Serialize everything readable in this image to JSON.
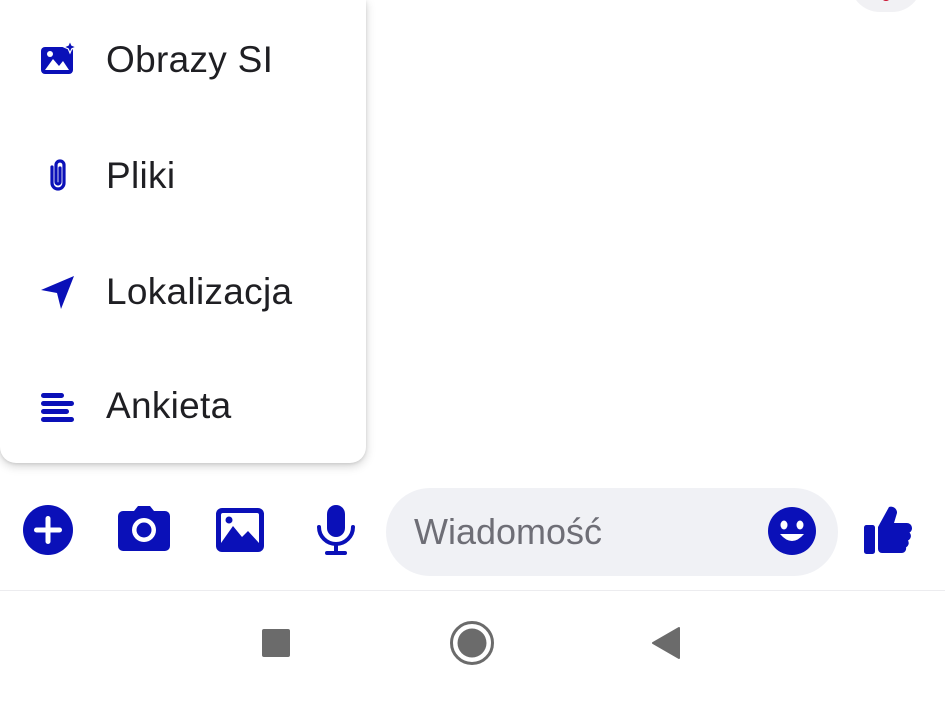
{
  "colors": {
    "accent": "#0a10b8",
    "text": "#1f1f23",
    "placeholder": "#6e6e76",
    "field_bg": "#f0f1f5",
    "nav_icon": "#6b6b6b"
  },
  "menu": {
    "items": [
      {
        "label": "Obrazy SI",
        "icon": "ai-image-icon"
      },
      {
        "label": "Pliki",
        "icon": "paperclip-icon"
      },
      {
        "label": "Lokalizacja",
        "icon": "location-arrow-icon"
      },
      {
        "label": "Ankieta",
        "icon": "poll-icon"
      }
    ]
  },
  "composer": {
    "buttons": [
      {
        "icon": "plus-circle-icon"
      },
      {
        "icon": "camera-icon"
      },
      {
        "icon": "gallery-icon"
      },
      {
        "icon": "microphone-icon"
      }
    ],
    "placeholder": "Wiadomość",
    "emoji_icon": "emoji-icon",
    "like_icon": "thumbs-up-icon"
  },
  "nav": {
    "buttons": [
      {
        "icon": "recents-square-icon"
      },
      {
        "icon": "home-circle-icon"
      },
      {
        "icon": "back-triangle-icon"
      }
    ]
  }
}
